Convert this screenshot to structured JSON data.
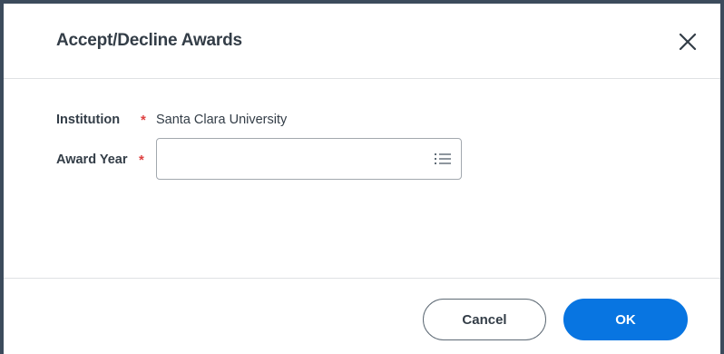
{
  "dialog": {
    "title": "Accept/Decline Awards",
    "close_icon": "close-icon"
  },
  "form": {
    "institution": {
      "label": "Institution",
      "required_mark": "*",
      "value": "Santa Clara University"
    },
    "award_year": {
      "label": "Award Year",
      "required_mark": "*",
      "value": "",
      "icon": "list-icon"
    }
  },
  "footer": {
    "cancel_label": "Cancel",
    "ok_label": "OK"
  },
  "colors": {
    "primary": "#0875e1",
    "required": "#de4040",
    "frame": "#3c4b5c"
  }
}
